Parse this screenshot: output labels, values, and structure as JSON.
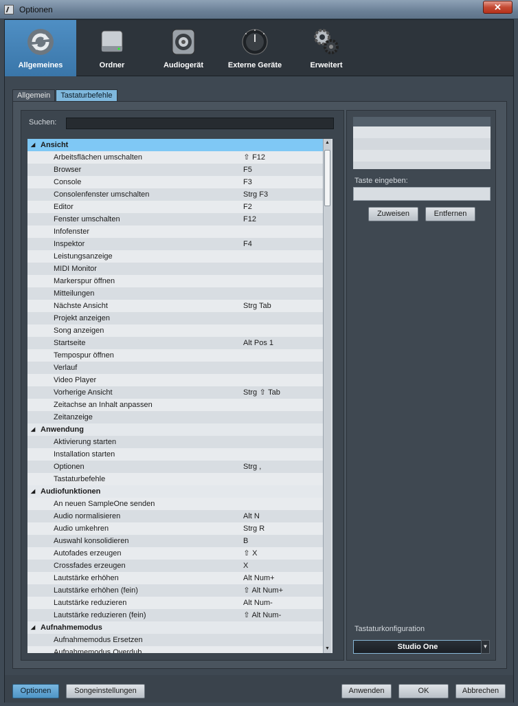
{
  "window": {
    "title": "Optionen",
    "close_label": "✕"
  },
  "categories": [
    {
      "label": "Allgemeines",
      "icon": "refresh-icon"
    },
    {
      "label": "Ordner",
      "icon": "drive-icon"
    },
    {
      "label": "Audiogerät",
      "icon": "speaker-icon"
    },
    {
      "label": "Externe Geräte",
      "icon": "knob-icon"
    },
    {
      "label": "Erweitert",
      "icon": "gears-icon"
    }
  ],
  "subtabs": [
    "Allgemein",
    "Tastaturbefehle"
  ],
  "search": {
    "label": "Suchen:",
    "value": ""
  },
  "tree": [
    {
      "type": "category",
      "name": "Ansicht"
    },
    {
      "name": "Arbeitsflächen umschalten",
      "shift": true,
      "key": "F12"
    },
    {
      "name": "Browser",
      "key": "F5"
    },
    {
      "name": "Console",
      "key": "F3"
    },
    {
      "name": "Consolenfenster umschalten",
      "key": "Strg  F3"
    },
    {
      "name": "Editor",
      "key": "F2"
    },
    {
      "name": "Fenster umschalten",
      "key": "F12"
    },
    {
      "name": "Infofenster",
      "key": ""
    },
    {
      "name": "Inspektor",
      "key": "F4"
    },
    {
      "name": "Leistungsanzeige",
      "key": ""
    },
    {
      "name": "MIDI Monitor",
      "key": ""
    },
    {
      "name": "Markerspur öffnen",
      "key": ""
    },
    {
      "name": "Mitteilungen",
      "key": ""
    },
    {
      "name": "Nächste Ansicht",
      "key": "Strg  Tab"
    },
    {
      "name": "Projekt anzeigen",
      "key": ""
    },
    {
      "name": "Song anzeigen",
      "key": ""
    },
    {
      "name": "Startseite",
      "key": "Alt  Pos 1"
    },
    {
      "name": "Tempospur öffnen",
      "key": ""
    },
    {
      "name": "Verlauf",
      "key": ""
    },
    {
      "name": "Video Player",
      "key": ""
    },
    {
      "name": "Vorherige Ansicht",
      "key_pre": "Strg",
      "shift": true,
      "key": "Tab"
    },
    {
      "name": "Zeitachse an Inhalt anpassen",
      "key": ""
    },
    {
      "name": "Zeitanzeige",
      "key": ""
    },
    {
      "type": "category",
      "name": "Anwendung"
    },
    {
      "name": "Aktivierung starten",
      "key": ""
    },
    {
      "name": "Installation starten",
      "key": ""
    },
    {
      "name": "Optionen",
      "key": "Strg  ,"
    },
    {
      "name": "Tastaturbefehle",
      "key": ""
    },
    {
      "type": "category",
      "name": "Audiofunktionen"
    },
    {
      "name": "An neuen SampleOne senden",
      "key": ""
    },
    {
      "name": "Audio normalisieren",
      "key": "Alt  N"
    },
    {
      "name": "Audio umkehren",
      "key": "Strg  R"
    },
    {
      "name": "Auswahl konsolidieren",
      "key": "B"
    },
    {
      "name": "Autofades erzeugen",
      "shift": true,
      "key": "X"
    },
    {
      "name": "Crossfades erzeugen",
      "key": "X"
    },
    {
      "name": "Lautstärke erhöhen",
      "key": "Alt  Num+"
    },
    {
      "name": "Lautstärke erhöhen (fein)",
      "shift": true,
      "key": "Alt  Num+"
    },
    {
      "name": "Lautstärke reduzieren",
      "key": "Alt  Num-"
    },
    {
      "name": "Lautstärke reduzieren (fein)",
      "shift": true,
      "key": "Alt  Num-"
    },
    {
      "type": "category",
      "name": "Aufnahmemodus"
    },
    {
      "name": "Aufnahmemodus Ersetzen",
      "key": ""
    },
    {
      "name": "Aufnahmemodus Overdub",
      "key": ""
    }
  ],
  "right": {
    "taste_label": "Taste eingeben:",
    "assign_label": "Zuweisen",
    "remove_label": "Entfernen",
    "config_label": "Tastaturkonfiguration",
    "config_value": "Studio One"
  },
  "bottom": {
    "options_label": "Optionen",
    "song_settings_label": "Songeinstellungen",
    "apply_label": "Anwenden",
    "ok_label": "OK",
    "cancel_label": "Abbrechen"
  }
}
